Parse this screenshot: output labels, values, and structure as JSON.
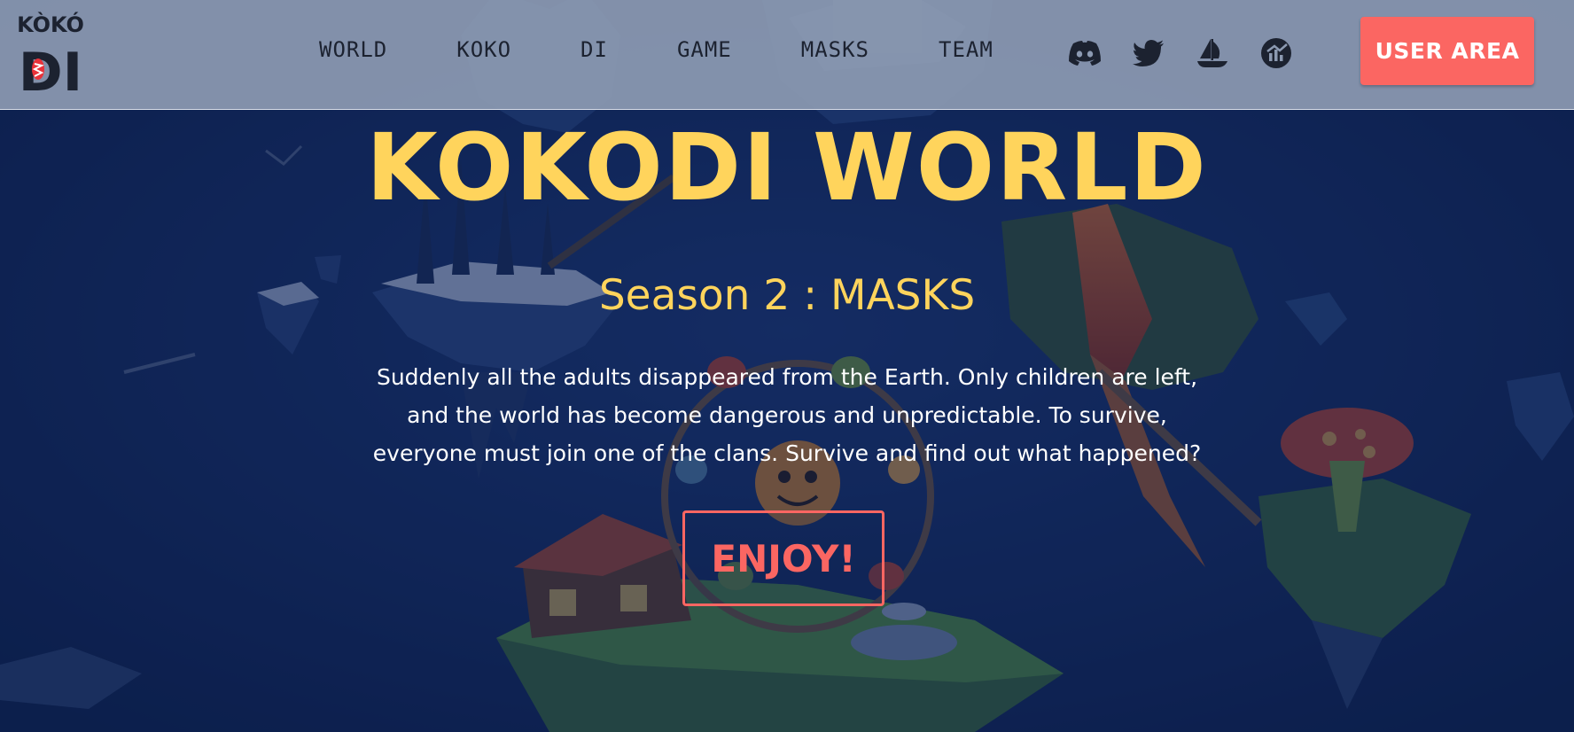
{
  "brand": {
    "logo_top": "KÒKÓ",
    "logo_bottom": "DI"
  },
  "nav": {
    "items": [
      {
        "label": "WORLD"
      },
      {
        "label": "KOKO"
      },
      {
        "label": "DI"
      },
      {
        "label": "GAME"
      },
      {
        "label": "MASKS"
      },
      {
        "label": "TEAM"
      }
    ]
  },
  "social": [
    {
      "name": "discord-icon"
    },
    {
      "name": "twitter-icon"
    },
    {
      "name": "opensea-ship-icon"
    },
    {
      "name": "chart-circle-icon"
    }
  ],
  "header": {
    "user_area_label": "USER AREA"
  },
  "hero": {
    "title": "KOKODI WORLD",
    "subtitle": "Season 2 : MASKS",
    "description_lines": [
      "Suddenly all the adults disappeared from the Earth. Only children are left,",
      "and the world has become dangerous and unpredictable. To survive,",
      "everyone must join one of the clans. Survive and find out what happened?"
    ],
    "cta_label": "ENJOY!"
  },
  "colors": {
    "accent_coral": "#fb6662",
    "title_yellow": "#ffd45c",
    "header_bg": "#8c9ab2",
    "page_bg": "#10275a"
  }
}
